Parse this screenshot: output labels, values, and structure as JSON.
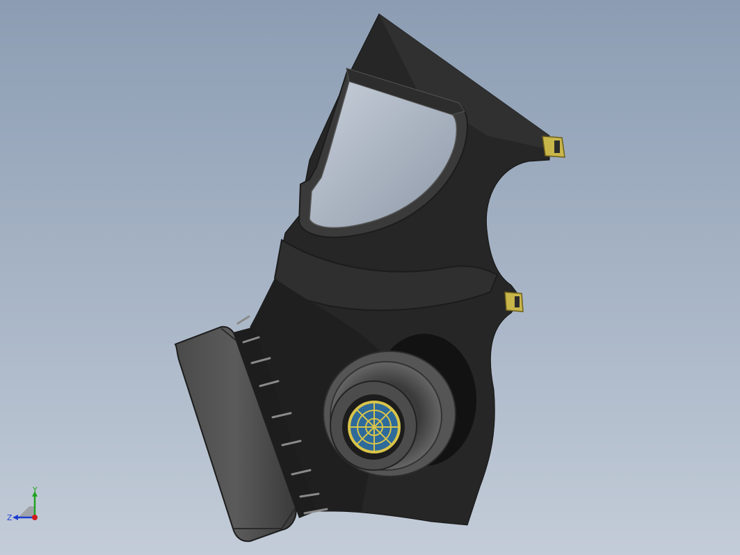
{
  "viewport": {
    "background_top": "#8c9db3",
    "background_bottom": "#c3ccd8"
  },
  "model": {
    "object": "gas-mask",
    "colors": {
      "rubber": "#2a2a2a",
      "rubber_shadow": "#1b1b1b",
      "rubber_highlight": "#3d3d3d",
      "visor": "#b9c3cf",
      "strap_buckle": "#c8b64a",
      "filter_grille": "#2e6a9a",
      "filter_grille_lines": "#d8c44a"
    }
  },
  "triad": {
    "x_color": "#d01c1c",
    "y_label": "Y",
    "y_color": "#1fa31f",
    "z_label": "Z",
    "z_color": "#1c3fd0"
  }
}
